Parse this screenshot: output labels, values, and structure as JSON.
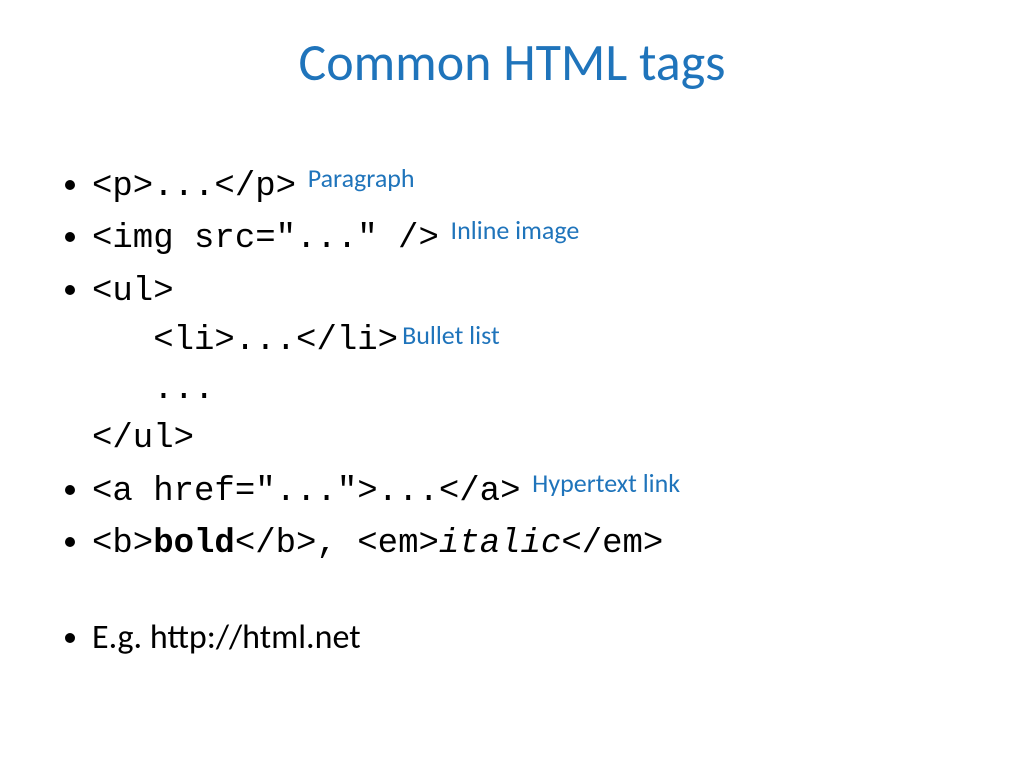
{
  "title": "Common HTML tags",
  "items": {
    "p": {
      "code": "<p>...</p>",
      "annot": "Paragraph"
    },
    "img": {
      "code": "<img src=\"...\" />",
      "annot": "Inline image"
    },
    "ul_open": "<ul>",
    "li_line_code": "<li>...</li>",
    "li_line_annot": "Bullet list",
    "dots_line": "...",
    "ul_close": "</ul>",
    "a": {
      "code": "<a href=\"...\">...</a>",
      "annot": "Hypertext link"
    },
    "b_open": "<b>",
    "bold_word": "bold",
    "b_close_comma": "</b>, ",
    "em_open": "<em>",
    "italic_word": "italic",
    "em_close": "</em>",
    "ref": "E.g. http://html.net"
  }
}
